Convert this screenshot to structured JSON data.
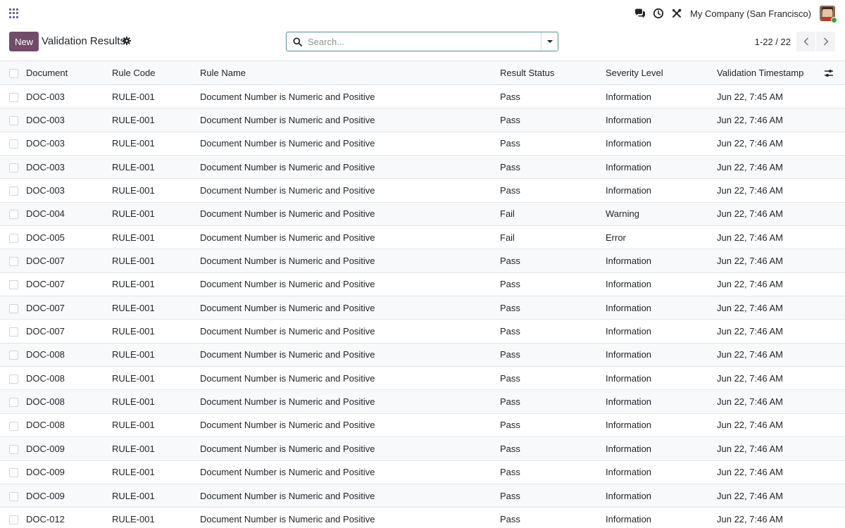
{
  "navbar": {
    "company": "My Company (San Francisco)",
    "icons": [
      "apps-grid-icon",
      "chat-icon",
      "clock-icon",
      "tools-icon"
    ],
    "accent_color": "#714b67"
  },
  "control": {
    "new_label": "New",
    "title": "Validation Results",
    "search_placeholder": "Search...",
    "pager": "1-22 / 22"
  },
  "table": {
    "columns": [
      "Document",
      "Rule Code",
      "Rule Name",
      "Result Status",
      "Severity Level",
      "Validation Timestamp"
    ],
    "rows": [
      {
        "document": "DOC-003",
        "rule_code": "RULE-001",
        "rule_name": "Document Number is Numeric and Positive",
        "status": "Pass",
        "severity": "Information",
        "timestamp": "Jun 22, 7:45 AM"
      },
      {
        "document": "DOC-003",
        "rule_code": "RULE-001",
        "rule_name": "Document Number is Numeric and Positive",
        "status": "Pass",
        "severity": "Information",
        "timestamp": "Jun 22, 7:46 AM"
      },
      {
        "document": "DOC-003",
        "rule_code": "RULE-001",
        "rule_name": "Document Number is Numeric and Positive",
        "status": "Pass",
        "severity": "Information",
        "timestamp": "Jun 22, 7:46 AM"
      },
      {
        "document": "DOC-003",
        "rule_code": "RULE-001",
        "rule_name": "Document Number is Numeric and Positive",
        "status": "Pass",
        "severity": "Information",
        "timestamp": "Jun 22, 7:46 AM"
      },
      {
        "document": "DOC-003",
        "rule_code": "RULE-001",
        "rule_name": "Document Number is Numeric and Positive",
        "status": "Pass",
        "severity": "Information",
        "timestamp": "Jun 22, 7:46 AM"
      },
      {
        "document": "DOC-004",
        "rule_code": "RULE-001",
        "rule_name": "Document Number is Numeric and Positive",
        "status": "Fail",
        "severity": "Warning",
        "timestamp": "Jun 22, 7:46 AM"
      },
      {
        "document": "DOC-005",
        "rule_code": "RULE-001",
        "rule_name": "Document Number is Numeric and Positive",
        "status": "Fail",
        "severity": "Error",
        "timestamp": "Jun 22, 7:46 AM"
      },
      {
        "document": "DOC-007",
        "rule_code": "RULE-001",
        "rule_name": "Document Number is Numeric and Positive",
        "status": "Pass",
        "severity": "Information",
        "timestamp": "Jun 22, 7:46 AM"
      },
      {
        "document": "DOC-007",
        "rule_code": "RULE-001",
        "rule_name": "Document Number is Numeric and Positive",
        "status": "Pass",
        "severity": "Information",
        "timestamp": "Jun 22, 7:46 AM"
      },
      {
        "document": "DOC-007",
        "rule_code": "RULE-001",
        "rule_name": "Document Number is Numeric and Positive",
        "status": "Pass",
        "severity": "Information",
        "timestamp": "Jun 22, 7:46 AM"
      },
      {
        "document": "DOC-007",
        "rule_code": "RULE-001",
        "rule_name": "Document Number is Numeric and Positive",
        "status": "Pass",
        "severity": "Information",
        "timestamp": "Jun 22, 7:46 AM"
      },
      {
        "document": "DOC-008",
        "rule_code": "RULE-001",
        "rule_name": "Document Number is Numeric and Positive",
        "status": "Pass",
        "severity": "Information",
        "timestamp": "Jun 22, 7:46 AM"
      },
      {
        "document": "DOC-008",
        "rule_code": "RULE-001",
        "rule_name": "Document Number is Numeric and Positive",
        "status": "Pass",
        "severity": "Information",
        "timestamp": "Jun 22, 7:46 AM"
      },
      {
        "document": "DOC-008",
        "rule_code": "RULE-001",
        "rule_name": "Document Number is Numeric and Positive",
        "status": "Pass",
        "severity": "Information",
        "timestamp": "Jun 22, 7:46 AM"
      },
      {
        "document": "DOC-008",
        "rule_code": "RULE-001",
        "rule_name": "Document Number is Numeric and Positive",
        "status": "Pass",
        "severity": "Information",
        "timestamp": "Jun 22, 7:46 AM"
      },
      {
        "document": "DOC-009",
        "rule_code": "RULE-001",
        "rule_name": "Document Number is Numeric and Positive",
        "status": "Pass",
        "severity": "Information",
        "timestamp": "Jun 22, 7:46 AM"
      },
      {
        "document": "DOC-009",
        "rule_code": "RULE-001",
        "rule_name": "Document Number is Numeric and Positive",
        "status": "Pass",
        "severity": "Information",
        "timestamp": "Jun 22, 7:46 AM"
      },
      {
        "document": "DOC-009",
        "rule_code": "RULE-001",
        "rule_name": "Document Number is Numeric and Positive",
        "status": "Pass",
        "severity": "Information",
        "timestamp": "Jun 22, 7:46 AM"
      },
      {
        "document": "DOC-012",
        "rule_code": "RULE-001",
        "rule_name": "Document Number is Numeric and Positive",
        "status": "Pass",
        "severity": "Information",
        "timestamp": "Jun 22, 7:46 AM"
      }
    ]
  }
}
